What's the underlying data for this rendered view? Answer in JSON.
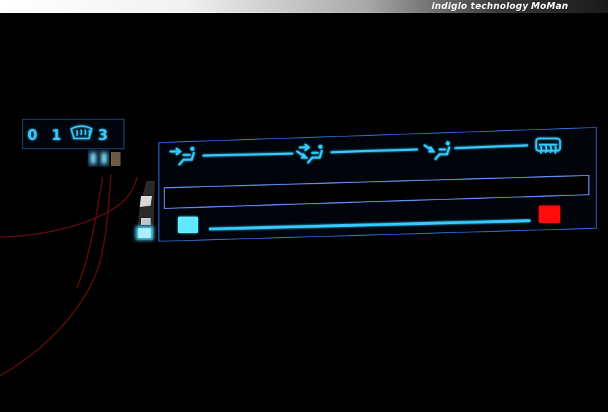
{
  "header": {
    "brand_text": "indiglo technology",
    "brand_signature": "MoMan"
  },
  "fan_switch": {
    "label_off": "0",
    "label_low": "1",
    "label_high": "3",
    "middle_icon": "windshield-defrost-icon"
  },
  "panel": {
    "airflow_modes": [
      "face-vent-icon",
      "face-and-foot-vent-icon",
      "foot-vent-icon",
      "rear-defrost-icon"
    ],
    "temperature_cold_color": "#5ee8ff",
    "temperature_hot_color": "#ff1111",
    "glow_color": "#34c9ff"
  }
}
